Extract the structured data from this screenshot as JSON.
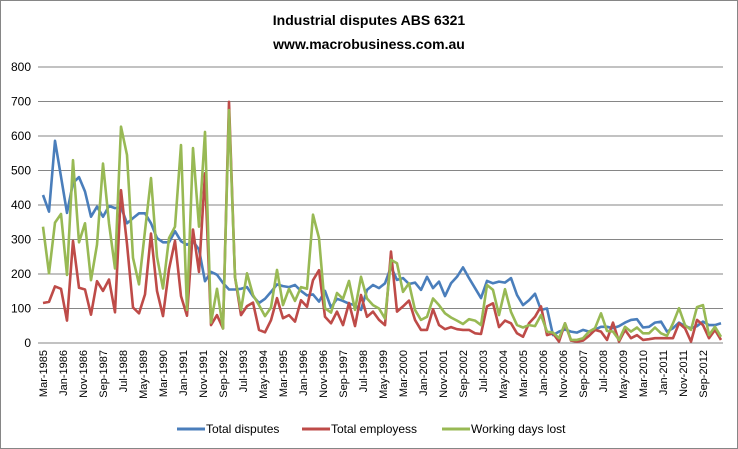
{
  "chart_data": {
    "type": "line",
    "title": "Industrial disputes ABS 6321",
    "subtitle": "www.macrobusiness.com.au",
    "xlabel": "",
    "ylabel": "",
    "ylim": [
      0,
      800
    ],
    "yticks": [
      0,
      100,
      200,
      300,
      400,
      500,
      600,
      700,
      800
    ],
    "grid": true,
    "legend": "bottom",
    "x_start": "Mar-1985",
    "x_step_months": 3,
    "x_tick_step_months": 10,
    "x_tick_labels": [
      "Mar-1985",
      "Jan-1986",
      "Nov-1986",
      "Sep-1987",
      "Jul-1988",
      "May-1989",
      "Mar-1990",
      "Jan-1991",
      "Nov-1991",
      "Sep-1992",
      "Jul-1993",
      "May-1994",
      "Mar-1995",
      "Jan-1996",
      "Nov-1996",
      "Sep-1997",
      "Jul-1998",
      "May-1999",
      "Mar-2000",
      "Jan-2001",
      "Nov-2001",
      "Sep-2002",
      "Jul-2003",
      "May-2004",
      "Mar-2005",
      "Jan-2006",
      "Nov-2006",
      "Sep-2007",
      "Jul-2008",
      "May-2009",
      "Mar-2010",
      "Jan-2011",
      "Nov-2011",
      "Sep-2012"
    ],
    "series": [
      {
        "name": "Total disputes",
        "color": "#4A7EBB",
        "values": [
          429,
          381,
          586,
          482,
          377,
          464,
          481,
          439,
          366,
          395,
          366,
          397,
          391,
          394,
          347,
          362,
          376,
          376,
          347,
          304,
          292,
          292,
          324,
          295,
          285,
          295,
          271,
          179,
          206,
          198,
          174,
          155,
          155,
          157,
          162,
          136,
          116,
          128,
          148,
          170,
          165,
          162,
          168,
          151,
          138,
          141,
          120,
          151,
          103,
          128,
          122,
          114,
          110,
          96,
          154,
          168,
          159,
          173,
          221,
          183,
          188,
          171,
          175,
          154,
          192,
          159,
          178,
          136,
          173,
          192,
          219,
          188,
          159,
          130,
          180,
          173,
          178,
          175,
          188,
          139,
          110,
          124,
          143,
          96,
          100,
          23,
          33,
          39,
          33,
          30,
          38,
          33,
          39,
          47,
          47,
          43,
          49,
          59,
          67,
          69,
          45,
          47,
          59,
          62,
          33,
          43,
          59,
          49,
          43,
          49,
          62,
          52,
          52,
          57
        ]
      },
      {
        "name": "Total employess",
        "color": "#BE4B48",
        "values": [
          116,
          119,
          164,
          157,
          65,
          296,
          160,
          155,
          82,
          179,
          151,
          184,
          89,
          443,
          287,
          103,
          86,
          141,
          317,
          151,
          78,
          214,
          296,
          136,
          79,
          329,
          206,
          492,
          52,
          81,
          42,
          699,
          191,
          81,
          107,
          117,
          38,
          31,
          66,
          130,
          72,
          81,
          62,
          124,
          105,
          182,
          211,
          76,
          57,
          91,
          52,
          116,
          49,
          139,
          76,
          91,
          67,
          52,
          265,
          91,
          106,
          123,
          67,
          38,
          38,
          98,
          52,
          40,
          46,
          40,
          38,
          38,
          28,
          26,
          106,
          115,
          46,
          65,
          57,
          28,
          18,
          57,
          76,
          106,
          23,
          28,
          4,
          57,
          7,
          4,
          7,
          21,
          38,
          33,
          9,
          59,
          4,
          38,
          14,
          23,
          9,
          11,
          14,
          14,
          14,
          14,
          57,
          43,
          4,
          67,
          52,
          14,
          38,
          9
        ]
      },
      {
        "name": "Working days lost",
        "color": "#98B954",
        "values": [
          337,
          202,
          349,
          374,
          197,
          530,
          292,
          347,
          182,
          285,
          520,
          347,
          216,
          627,
          545,
          247,
          170,
          325,
          478,
          250,
          158,
          304,
          337,
          574,
          96,
          565,
          337,
          612,
          59,
          157,
          42,
          675,
          191,
          96,
          202,
          139,
          110,
          78,
          103,
          212,
          110,
          157,
          122,
          162,
          157,
          372,
          304,
          101,
          88,
          145,
          128,
          180,
          96,
          192,
          129,
          110,
          100,
          71,
          241,
          231,
          148,
          173,
          96,
          67,
          76,
          129,
          110,
          86,
          74,
          65,
          55,
          69,
          65,
          52,
          168,
          154,
          81,
          156,
          90,
          52,
          45,
          52,
          49,
          81,
          33,
          30,
          14,
          57,
          9,
          9,
          14,
          33,
          43,
          86,
          35,
          33,
          9,
          47,
          33,
          45,
          28,
          28,
          45,
          28,
          21,
          57,
          101,
          52,
          38,
          104,
          110,
          23,
          47,
          18
        ]
      }
    ]
  }
}
